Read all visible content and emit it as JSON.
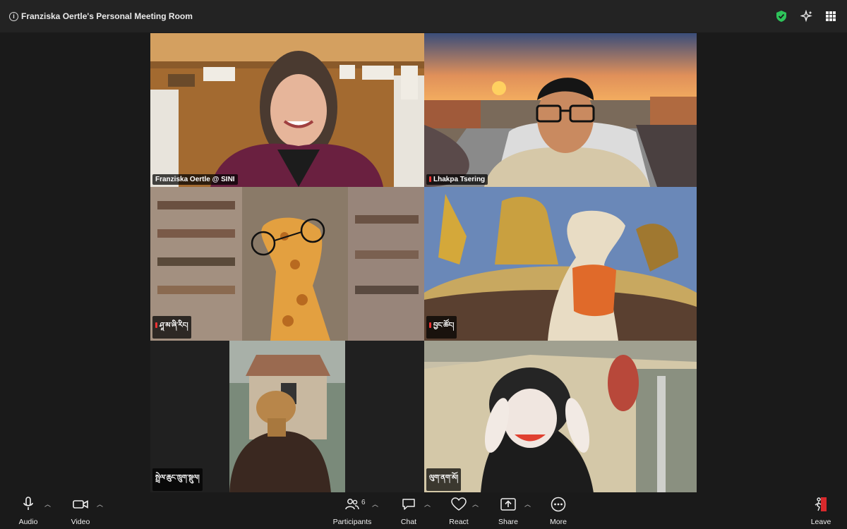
{
  "window": {
    "title": "Franziska Oertle's Personal Meeting Room"
  },
  "icons": {
    "info": "info-icon",
    "security": "shield-icon",
    "ai_companion": "sparkle-icon",
    "view": "grid-icon"
  },
  "participants": [
    {
      "name": "Franziska Oertle @ SINI",
      "muted": false,
      "active_speaker": true
    },
    {
      "name": "Lhakpa Tsering",
      "muted": true,
      "active_speaker": false
    },
    {
      "name": "ཤཱ་མ་ཞི་རིང།",
      "muted": true,
      "active_speaker": false
    },
    {
      "name": "བྱང་ཚོང།",
      "muted": true,
      "active_speaker": false
    },
    {
      "name": "སྤྲེལ་ཆུང་ཁྲུག་སྡུལ།",
      "muted": false,
      "active_speaker": false
    },
    {
      "name": "ལུག་ནག་མོ།",
      "muted": false,
      "active_speaker": false
    }
  ],
  "toolbar": {
    "audio_label": "Audio",
    "video_label": "Video",
    "participants_label": "Participants",
    "participants_count": "6",
    "chat_label": "Chat",
    "react_label": "React",
    "share_label": "Share",
    "more_label": "More",
    "leave_label": "Leave"
  },
  "colors": {
    "active_speaker_border": "#2ec35a",
    "muted_indicator": "#e33333",
    "security_green": "#2ec35a",
    "background": "#1a1a1a"
  }
}
